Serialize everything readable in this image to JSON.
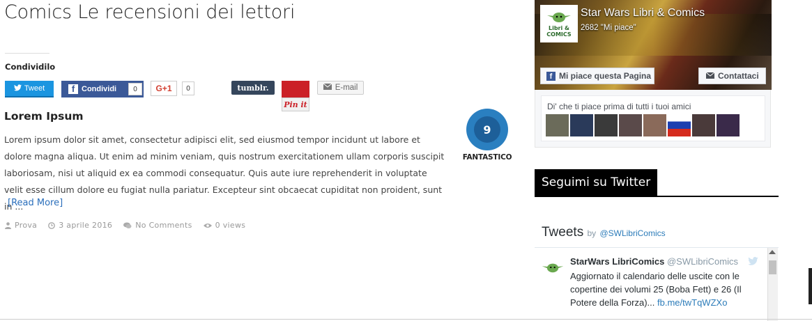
{
  "page": {
    "title": "Comics Le recensioni dei lettori"
  },
  "share": {
    "label": "Condividilo",
    "twitter_label": "Tweet",
    "facebook_label": "Condividi",
    "facebook_count": "0",
    "google_label": "G+1",
    "google_count": "0",
    "tumblr_label": "tumblr.",
    "pinterest_label": "Pin it",
    "email_label": "E-mail"
  },
  "post": {
    "title": "Lorem Ipsum",
    "excerpt": "Lorem ipsum dolor sit amet, consectetur adipisci elit, sed eiusmod tempor incidunt ut labore et dolore magna aliqua. Ut enim ad minim veniam, quis nostrum exercitationem ullam corporis suscipit laboriosam, nisi ut aliquid ex ea commodi consequatur. Quis aute iure reprehenderit in voluptate velit esse cillum dolore eu fugiat nulla pariatur. Excepteur sint obcaecat cupiditat non proident, sunt in ...",
    "read_more": "[Read More]",
    "author": "Prova",
    "date": "3 aprile 2016",
    "comments": "No Comments",
    "views": "0 views",
    "score": "9",
    "score_label": "FANTASTICO"
  },
  "facebook_widget": {
    "page_name": "Star Wars Libri & Comics",
    "likes": "2682 \"Mi piace\"",
    "like_button": "Mi piace questa Pagina",
    "contact_button": "Contattaci",
    "friends_text": "Di' che ti piace prima di tutti i tuoi amici",
    "logo_text": "Libri & COMICS",
    "friend_colors": [
      "#6b6b5a",
      "#2a3a5a",
      "#3a3a3a",
      "#5a4a4a",
      "#8a6a5a",
      "#ffffff",
      "#4a3a3a",
      "#3a2a4a"
    ]
  },
  "twitter": {
    "section_title": "Seguimi su Twitter",
    "box_title": "Tweets",
    "by": "by",
    "handle_link": "@SWLibriComics",
    "tweet_name": "StarWars LibriComics",
    "tweet_handle": "@SWLibriComics",
    "tweet_text": "Aggiornato il calendario delle uscite con le copertine dei volumi 25 (Boba Fett) e 26 (Il Potere della Forza)...",
    "tweet_link": "fb.me/twTqWZXo"
  },
  "colors": {
    "twitter": "#1b95e0",
    "facebook": "#3b5998",
    "tumblr": "#35465c",
    "pinterest": "#cb2027",
    "score": "#2a7fc0",
    "link": "#2a6ebb"
  },
  "icons": [
    "twitter-bird-icon",
    "facebook-f-icon",
    "envelope-icon",
    "user-icon",
    "clock-icon",
    "comments-icon",
    "eye-icon",
    "yoda-avatar-icon"
  ]
}
